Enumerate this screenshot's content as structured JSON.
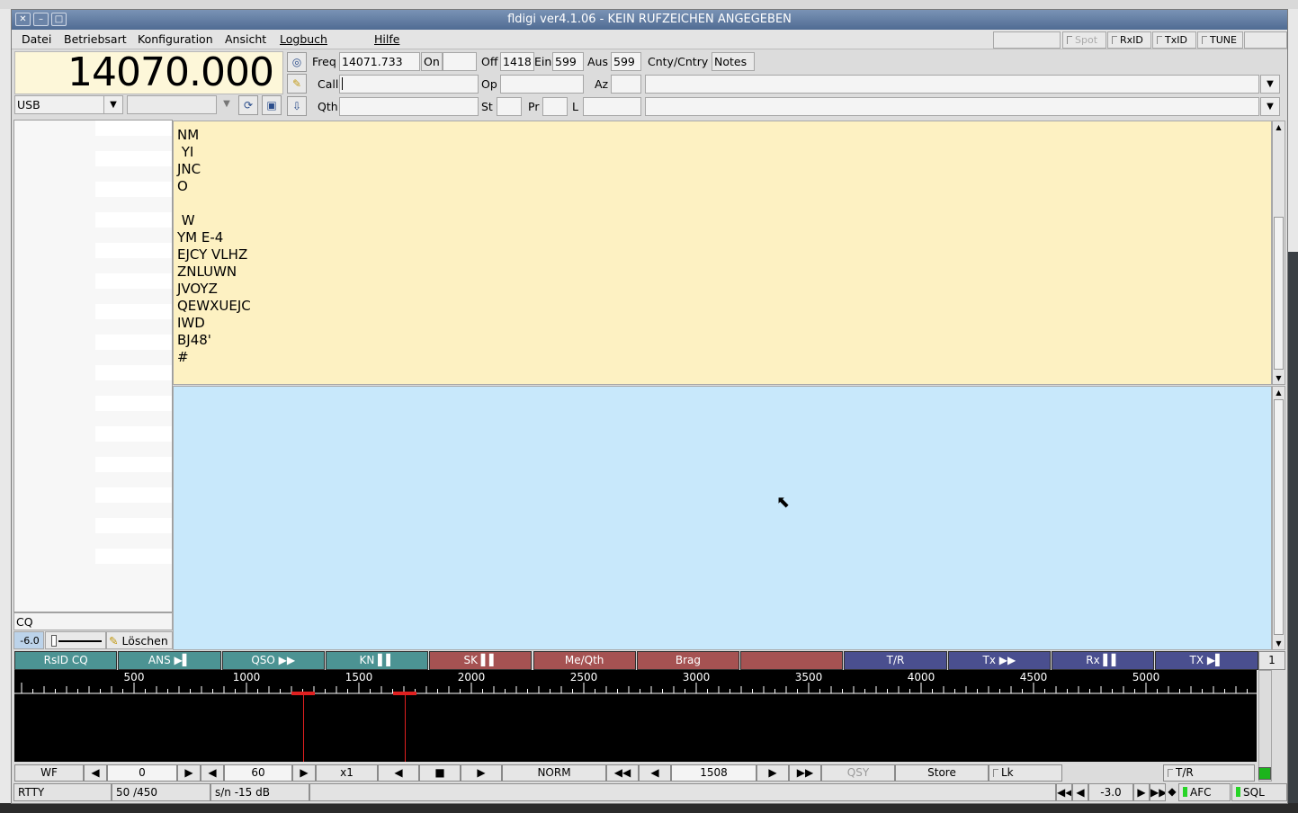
{
  "window": {
    "title": "fldigi ver4.1.06 - KEIN RUFZEICHEN ANGEGEBEN",
    "close_icon": "✕",
    "min_icon": "–",
    "max_icon": "□"
  },
  "menu": [
    "Datei",
    "Betriebsart",
    "Konfiguration",
    "Ansicht",
    "Logbuch",
    "Hilfe"
  ],
  "menu_right": {
    "spot": "Spot",
    "rxid": "RxID",
    "txid": "TxID",
    "tune": "TUNE"
  },
  "freq_display": "14070.000",
  "mode_select": "USB",
  "log": {
    "freq_label": "Freq",
    "freq": "14071.733",
    "on_label": "On",
    "on": "",
    "off_label": "Off",
    "off": "1418",
    "ein_label": "Ein",
    "ein": "599",
    "aus_label": "Aus",
    "aus": "599",
    "cnty_label": "Cnty/Cntry",
    "notes_label": "Notes",
    "call_label": "Call",
    "call": "",
    "op_label": "Op",
    "op": "",
    "az_label": "Az",
    "az": "",
    "qth_label": "Qth",
    "qth": "",
    "st_label": "St",
    "st": "",
    "pr_label": "Pr",
    "pr": "",
    "l_label": "L",
    "l": ""
  },
  "rx_text": "NM\n YI\nJNC\nO\n\n W\nYM E-4\nEJCY VLHZ\nZNLUWN\nJVOYZ\nQEWXUEJC\nIWD\nBJ48'\n#",
  "left_panel": {
    "cq": "CQ",
    "level": "-6.0",
    "clear": "Löschen"
  },
  "macros": {
    "row_label": "1",
    "buttons": [
      {
        "label": "RsID CQ",
        "color": "teal"
      },
      {
        "label": "ANS ▶▌",
        "color": "teal"
      },
      {
        "label": "QSO ▶▶",
        "color": "teal"
      },
      {
        "label": "KN ▌▌",
        "color": "teal"
      },
      {
        "label": "SK ▌▌",
        "color": "red"
      },
      {
        "label": "Me/Qth",
        "color": "red"
      },
      {
        "label": "Brag",
        "color": "red"
      },
      {
        "label": "",
        "color": "red"
      },
      {
        "label": "T/R",
        "color": "blue"
      },
      {
        "label": "Tx ▶▶",
        "color": "blue"
      },
      {
        "label": "Rx ▌▌",
        "color": "blue"
      },
      {
        "label": "TX ▶▌",
        "color": "blue"
      }
    ]
  },
  "scale_ticks": [
    "500",
    "1000",
    "1500",
    "2000",
    "2500",
    "3000",
    "3500",
    "4000",
    "4500",
    "5000"
  ],
  "waterfall": {
    "wf_btn": "WF",
    "offset": "0",
    "speed": "60",
    "zoom": "x1",
    "mode": "NORM",
    "carrier": "1508",
    "qsy": "QSY",
    "store": "Store",
    "lock": "Lk",
    "tr": "T/R"
  },
  "status": {
    "mode": "RTTY",
    "rate": "50 /450",
    "sn": "s/n -15 dB",
    "afc_val": "-3.0",
    "afc": "AFC",
    "sql": "SQL"
  },
  "colors": {
    "rx_bg": "#fdf1c2",
    "tx_bg": "#c8e8fb",
    "freq_bg": "#fdf7d9",
    "marker": "#e02020"
  }
}
